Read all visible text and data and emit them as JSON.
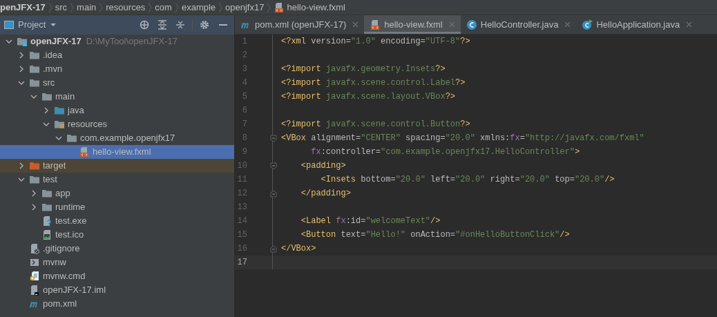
{
  "breadcrumbs": [
    {
      "label": "penJFX-17",
      "kind": "project"
    },
    {
      "label": "src",
      "kind": "folder"
    },
    {
      "label": "main",
      "kind": "folder"
    },
    {
      "label": "resources",
      "kind": "folder"
    },
    {
      "label": "com",
      "kind": "folder"
    },
    {
      "label": "example",
      "kind": "folder"
    },
    {
      "label": "openjfx17",
      "kind": "folder"
    },
    {
      "label": "hello-view.fxml",
      "kind": "fxml"
    }
  ],
  "project_panel": {
    "title": "Project"
  },
  "tree": [
    {
      "label": "openJFX-17",
      "detail": "D:\\MyTool\\openJFX-17",
      "kind": "module",
      "expanded": true,
      "selected": false,
      "children": [
        {
          "label": ".idea",
          "kind": "folder",
          "expanded": false,
          "selected": false
        },
        {
          "label": ".mvn",
          "kind": "folder",
          "expanded": false,
          "selected": false
        },
        {
          "label": "src",
          "kind": "folder",
          "expanded": true,
          "selected": false,
          "children": [
            {
              "label": "main",
              "kind": "folder",
              "expanded": true,
              "selected": false,
              "children": [
                {
                  "label": "java",
                  "kind": "source",
                  "expanded": false,
                  "selected": false
                },
                {
                  "label": "resources",
                  "kind": "resources",
                  "expanded": true,
                  "selected": false,
                  "children": [
                    {
                      "label": "com.example.openjfx17",
                      "kind": "folder",
                      "expanded": true,
                      "selected": false,
                      "children": [
                        {
                          "label": "hello-view.fxml",
                          "kind": "fxml",
                          "selected": true
                        }
                      ]
                    }
                  ]
                }
              ]
            }
          ]
        },
        {
          "label": "target",
          "kind": "excluded",
          "expanded": false,
          "selected": false
        },
        {
          "label": "test",
          "kind": "folder",
          "expanded": true,
          "selected": false,
          "children": [
            {
              "label": "app",
              "kind": "folder",
              "expanded": false,
              "selected": false
            },
            {
              "label": "runtime",
              "kind": "folder",
              "expanded": false,
              "selected": false
            },
            {
              "label": "test.exe",
              "kind": "unknown",
              "selected": false
            },
            {
              "label": "test.ico",
              "kind": "image",
              "selected": false
            }
          ]
        },
        {
          "label": ".gitignore",
          "kind": "ignore",
          "selected": false
        },
        {
          "label": "mvnw",
          "kind": "shell",
          "selected": false
        },
        {
          "label": "mvnw.cmd",
          "kind": "cmd",
          "selected": false
        },
        {
          "label": "openJFX-17.iml",
          "kind": "iml",
          "selected": false
        },
        {
          "label": "pom.xml",
          "kind": "maven",
          "selected": false
        }
      ]
    }
  ],
  "tabs": [
    {
      "label": "pom.xml (openJFX-17)",
      "kind": "maven",
      "selected": false
    },
    {
      "label": "hello-view.fxml",
      "kind": "fxml",
      "selected": true
    },
    {
      "label": "HelloController.java",
      "kind": "class",
      "selected": false
    },
    {
      "label": "HelloApplication.java",
      "kind": "app-class",
      "selected": false
    }
  ],
  "editor": {
    "lines": [
      {
        "number": "1",
        "kind": "plain",
        "current": false,
        "text": "<?xml version=\"1.0\" encoding=\"UTF-8\"?>"
      },
      {
        "number": "2",
        "kind": "plain",
        "current": false
      },
      {
        "number": "3",
        "kind": "plain",
        "current": false,
        "text": "<?import javafx.geometry.Insets?>"
      },
      {
        "number": "4",
        "kind": "plain",
        "current": false,
        "text": "<?import javafx.scene.control.Label?>"
      },
      {
        "number": "5",
        "kind": "plain",
        "current": false,
        "text": "<?import javafx.scene.layout.VBox?>"
      },
      {
        "number": "6",
        "kind": "plain",
        "current": false
      },
      {
        "number": "7",
        "kind": "plain",
        "current": false,
        "text": "<?import javafx.scene.control.Button?>"
      },
      {
        "number": "8",
        "kind": "fold-start",
        "current": false,
        "text": "<VBox alignment=\"CENTER\" spacing=\"20.0\" xmlns:fx=\"http://javafx.com/fxml\""
      },
      {
        "number": "9",
        "kind": "plain",
        "current": false,
        "text": "      fx:controller=\"com.example.openjfx17.HelloController\">"
      },
      {
        "number": "10",
        "kind": "fold-start",
        "current": false,
        "text": "    <padding>"
      },
      {
        "number": "11",
        "kind": "plain",
        "current": false,
        "text": "        <Insets bottom=\"20.0\" left=\"20.0\" right=\"20.0\" top=\"20.0\"/>"
      },
      {
        "number": "12",
        "kind": "fold-end",
        "current": false,
        "text": "    </padding>"
      },
      {
        "number": "13",
        "kind": "plain",
        "current": false
      },
      {
        "number": "14",
        "kind": "plain",
        "current": false,
        "text": "    <Label fx:id=\"welcomeText\"/>"
      },
      {
        "number": "15",
        "kind": "plain",
        "current": false,
        "text": "    <Button text=\"Hello!\" onAction=\"#onHelloButtonClick\"/>"
      },
      {
        "number": "16",
        "kind": "fold-end",
        "current": false,
        "text": "</VBox>"
      },
      {
        "number": "17",
        "kind": "plain",
        "current": true
      }
    ]
  }
}
